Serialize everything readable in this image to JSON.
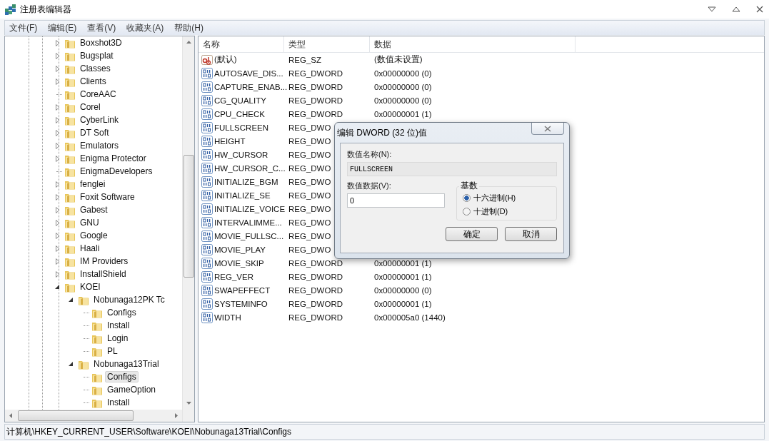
{
  "window": {
    "title": "注册表编辑器"
  },
  "menu": [
    "文件(F)",
    "编辑(E)",
    "查看(V)",
    "收藏夹(A)",
    "帮助(H)"
  ],
  "tree": {
    "items": [
      {
        "name": "Boxshot3D",
        "expandable": true,
        "expanded": false,
        "selected": false
      },
      {
        "name": "Bugsplat",
        "expandable": true,
        "expanded": false,
        "selected": false
      },
      {
        "name": "Classes",
        "expandable": true,
        "expanded": false,
        "selected": false
      },
      {
        "name": "Clients",
        "expandable": true,
        "expanded": false,
        "selected": false
      },
      {
        "name": "CoreAAC",
        "expandable": false,
        "selected": false
      },
      {
        "name": "Corel",
        "expandable": true,
        "expanded": false,
        "selected": false
      },
      {
        "name": "CyberLink",
        "expandable": true,
        "expanded": false,
        "selected": false
      },
      {
        "name": "DT Soft",
        "expandable": true,
        "expanded": false,
        "selected": false
      },
      {
        "name": "Emulators",
        "expandable": true,
        "expanded": false,
        "selected": false
      },
      {
        "name": "Enigma Protector",
        "expandable": true,
        "expanded": false,
        "selected": false
      },
      {
        "name": "EnigmaDevelopers",
        "expandable": false,
        "selected": false
      },
      {
        "name": "fenglei",
        "expandable": true,
        "expanded": false,
        "selected": false
      },
      {
        "name": "Foxit Software",
        "expandable": true,
        "expanded": false,
        "selected": false
      },
      {
        "name": "Gabest",
        "expandable": true,
        "expanded": false,
        "selected": false
      },
      {
        "name": "GNU",
        "expandable": true,
        "expanded": false,
        "selected": false
      },
      {
        "name": "Google",
        "expandable": true,
        "expanded": false,
        "selected": false
      },
      {
        "name": "Haali",
        "expandable": true,
        "expanded": false,
        "selected": false
      },
      {
        "name": "IM Providers",
        "expandable": true,
        "expanded": false,
        "selected": false
      },
      {
        "name": "InstallShield",
        "expandable": true,
        "expanded": false,
        "selected": false
      },
      {
        "name": "KOEI",
        "expandable": true,
        "expanded": true,
        "selected": false,
        "children": [
          {
            "name": "Nobunaga12PK Tc",
            "expandable": true,
            "expanded": true,
            "selected": false,
            "children": [
              {
                "name": "Configs",
                "expandable": false,
                "selected": false
              },
              {
                "name": "Install",
                "expandable": false,
                "selected": false
              },
              {
                "name": "Login",
                "expandable": false,
                "selected": false
              },
              {
                "name": "PL",
                "expandable": false,
                "selected": false
              }
            ]
          },
          {
            "name": "Nobunaga13Trial",
            "expandable": true,
            "expanded": true,
            "selected": false,
            "children": [
              {
                "name": "Configs",
                "expandable": false,
                "selected": true
              },
              {
                "name": "GameOption",
                "expandable": false,
                "selected": false
              },
              {
                "name": "Install",
                "expandable": false,
                "selected": false
              }
            ]
          }
        ]
      }
    ]
  },
  "table": {
    "columns": [
      "名称",
      "类型",
      "数据"
    ],
    "rows": [
      {
        "kind": "string",
        "name": "(默认)",
        "type": "REG_SZ",
        "data": "(数值未设置)"
      },
      {
        "kind": "dword",
        "name": "AUTOSAVE_DIS...",
        "type": "REG_DWORD",
        "data": "0x00000000 (0)"
      },
      {
        "kind": "dword",
        "name": "CAPTURE_ENAB...",
        "type": "REG_DWORD",
        "data": "0x00000000 (0)"
      },
      {
        "kind": "dword",
        "name": "CG_QUALITY",
        "type": "REG_DWORD",
        "data": "0x00000000 (0)"
      },
      {
        "kind": "dword",
        "name": "CPU_CHECK",
        "type": "REG_DWORD",
        "data": "0x00000001 (1)"
      },
      {
        "kind": "dword",
        "name": "FULLSCREEN",
        "type": "REG_DWO"
      },
      {
        "kind": "dword",
        "name": "HEIGHT",
        "type": "REG_DWO"
      },
      {
        "kind": "dword",
        "name": "HW_CURSOR",
        "type": "REG_DWO"
      },
      {
        "kind": "dword",
        "name": "HW_CURSOR_C...",
        "type": "REG_DWO"
      },
      {
        "kind": "dword",
        "name": "INITIALIZE_BGM",
        "type": "REG_DWO"
      },
      {
        "kind": "dword",
        "name": "INITIALIZE_SE",
        "type": "REG_DWO"
      },
      {
        "kind": "dword",
        "name": "INITIALIZE_VOICE",
        "type": "REG_DWO"
      },
      {
        "kind": "dword",
        "name": "INTERVALIMME...",
        "type": "REG_DWO"
      },
      {
        "kind": "dword",
        "name": "MOVIE_FULLSC...",
        "type": "REG_DWO"
      },
      {
        "kind": "dword",
        "name": "MOVIE_PLAY",
        "type": "REG_DWO"
      },
      {
        "kind": "dword",
        "name": "MOVIE_SKIP",
        "type": "REG_DWORD",
        "data": "0x00000001 (1)"
      },
      {
        "kind": "dword",
        "name": "REG_VER",
        "type": "REG_DWORD",
        "data": "0x00000001 (1)"
      },
      {
        "kind": "dword",
        "name": "SWAPEFFECT",
        "type": "REG_DWORD",
        "data": "0x00000000 (0)"
      },
      {
        "kind": "dword",
        "name": "SYSTEMINFO",
        "type": "REG_DWORD",
        "data": "0x00000001 (1)"
      },
      {
        "kind": "dword",
        "name": "WIDTH",
        "type": "REG_DWORD",
        "data": "0x000005a0 (1440)"
      }
    ]
  },
  "dialog": {
    "title": "编辑 DWORD (32 位)值",
    "name_label": "数值名称(N):",
    "name_value": "FULLSCREEN",
    "data_label": "数值数据(V):",
    "data_value": "0",
    "base_label": "基数",
    "bases": [
      {
        "label": "十六进制(H)",
        "selected": true
      },
      {
        "label": "十进制(D)",
        "selected": false
      }
    ],
    "buttons": [
      "确定",
      "取消"
    ]
  },
  "status_bar": "计算机\\HKEY_CURRENT_USER\\Software\\KOEI\\Nobunaga13Trial\\Configs"
}
